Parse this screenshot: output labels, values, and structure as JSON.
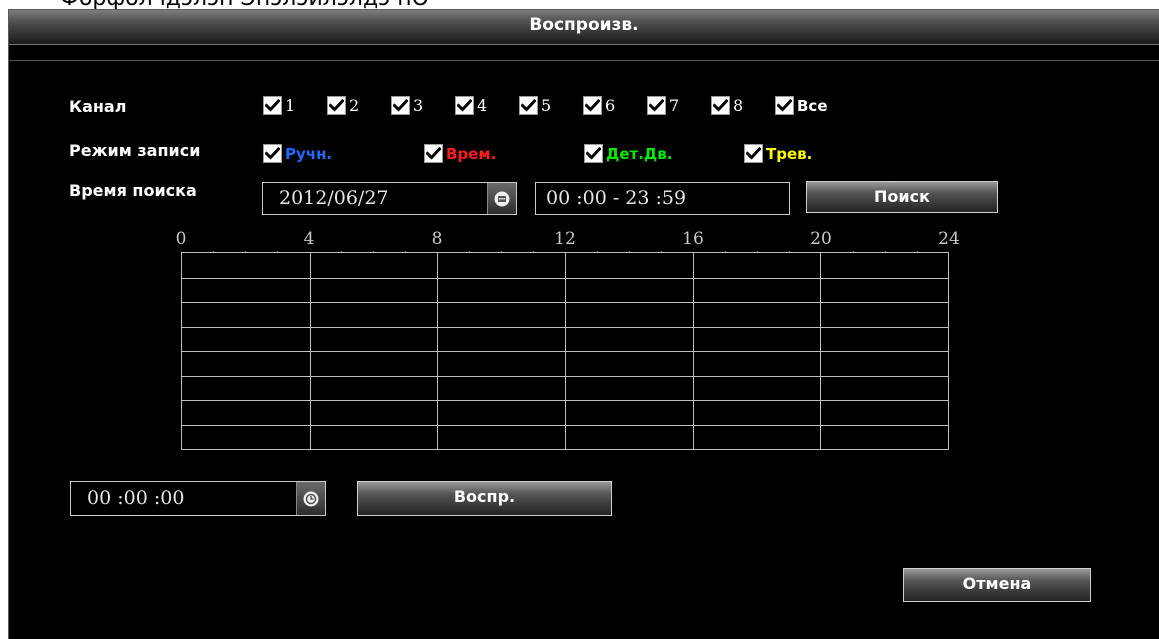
{
  "clipped_caption": "Форфолчдэлэн Эпэлэйлэлдэ нО",
  "window": {
    "title": "Воспроизв."
  },
  "channel": {
    "label": "Канал",
    "items": [
      {
        "label": "1",
        "checked": true
      },
      {
        "label": "2",
        "checked": true
      },
      {
        "label": "3",
        "checked": true
      },
      {
        "label": "4",
        "checked": true
      },
      {
        "label": "5",
        "checked": true
      },
      {
        "label": "6",
        "checked": true
      },
      {
        "label": "7",
        "checked": true
      },
      {
        "label": "8",
        "checked": true
      },
      {
        "label": "Все",
        "checked": true
      }
    ]
  },
  "record_mode": {
    "label": "Режим записи",
    "items": [
      {
        "label": "Ручн.",
        "checked": true,
        "color": "#1a6cff"
      },
      {
        "label": "Врем.",
        "checked": true,
        "color": "#ff1a1a"
      },
      {
        "label": "Дет.Дв.",
        "checked": true,
        "color": "#00ee00"
      },
      {
        "label": "Трев.",
        "checked": true,
        "color": "#ffff00"
      }
    ]
  },
  "search_time": {
    "label": "Время поиска",
    "date": "2012/06/27",
    "date_icon": "calendar-icon",
    "time_range": "00 :00 - 23 :59",
    "search_button": "Поиск"
  },
  "timeline": {
    "hour_ticks": [
      "0",
      "4",
      "8",
      "12",
      "16",
      "20",
      "24"
    ],
    "rows": 8
  },
  "playback": {
    "time": "00 :00 :00",
    "time_icon": "clock-icon",
    "play_button": "Воспр."
  },
  "cancel_button": "Отмена"
}
